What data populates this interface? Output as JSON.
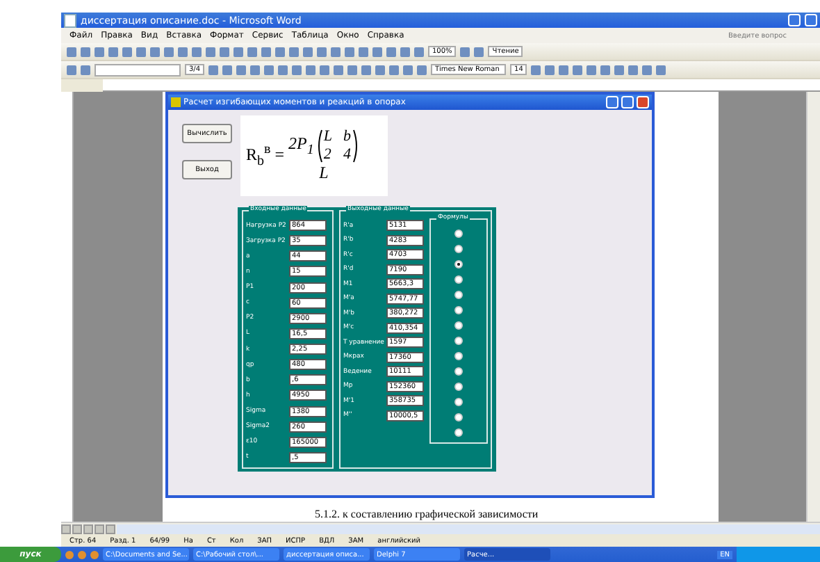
{
  "window": {
    "title": "диссертация описание.doc - Microsoft Word"
  },
  "menu": [
    "Файл",
    "Правка",
    "Вид",
    "Вставка",
    "Формат",
    "Сервис",
    "Таблица",
    "Окно",
    "Справка"
  ],
  "help_search": {
    "placeholder": "Введите вопрос"
  },
  "toolbar": {
    "zoom": "100%",
    "reading": "Чтение",
    "line_width": "3/4",
    "font": "Times New Roman",
    "size": "14"
  },
  "dialog": {
    "title": "Расчет изгибающих моментов и реакций в опорах",
    "buttons": [
      "Вычислить",
      "Выход"
    ],
    "formula": {
      "lhs": "R$_{b}$$^{в}$ =",
      "numerator": "2P$_{1}$",
      "matrix": [
        "L",
        "b",
        "2",
        "4"
      ],
      "denominator": "L"
    },
    "inputs_title": "Входные данные",
    "inputs": [
      {
        "label": "Нагрузка P2",
        "value": "864"
      },
      {
        "label": "Загрузка Р2",
        "value": "35"
      },
      {
        "label": "a",
        "value": "44"
      },
      {
        "label": "n",
        "value": "15"
      },
      {
        "label": "Р1",
        "value": "200"
      },
      {
        "label": "c",
        "value": "60"
      },
      {
        "label": "P2",
        "value": "2900"
      },
      {
        "label": "L",
        "value": "16,5"
      },
      {
        "label": "k",
        "value": "2,25"
      },
      {
        "label": "qp",
        "value": "480"
      },
      {
        "label": "b",
        "value": ",6"
      },
      {
        "label": "h",
        "value": "4950"
      },
      {
        "label": "Sigma",
        "value": "1380"
      },
      {
        "label": "Sigma2",
        "value": "260"
      },
      {
        "label": "ε10",
        "value": "165000"
      },
      {
        "label": "t",
        "value": ",5"
      }
    ],
    "outputs_title": "Выходные данные",
    "outputs": [
      {
        "label": "R'a",
        "value": "5131"
      },
      {
        "label": "R'b",
        "value": "4283"
      },
      {
        "label": "R'c",
        "value": "4703"
      },
      {
        "label": "R'd",
        "value": "7190"
      },
      {
        "label": "M1",
        "value": "5663,3"
      },
      {
        "label": "M'a",
        "value": "5747,77"
      },
      {
        "label": "M'b",
        "value": "380,272"
      },
      {
        "label": "M'c",
        "value": "410,354"
      },
      {
        "label": "T уравнение",
        "value": "1597"
      },
      {
        "label": "Мкрах",
        "value": "17360"
      },
      {
        "label": "Ведение",
        "value": "10111"
      },
      {
        "label": "Мр",
        "value": "152360"
      },
      {
        "label": "M'1",
        "value": "358735"
      },
      {
        "label": "M''",
        "value": "10000,5"
      }
    ],
    "formulas_title": "Формулы",
    "formula_options": [
      {
        "selected": false
      },
      {
        "selected": false
      },
      {
        "selected": true
      },
      {
        "selected": false
      },
      {
        "selected": false
      },
      {
        "selected": false
      },
      {
        "selected": false
      },
      {
        "selected": false
      },
      {
        "selected": false
      },
      {
        "selected": false
      },
      {
        "selected": false
      },
      {
        "selected": false
      },
      {
        "selected": false
      },
      {
        "selected": false
      }
    ]
  },
  "document_text": "5.1.2. к составлению графической зависимости",
  "status_bar": [
    "Стр. 64",
    "Разд. 1",
    "64/99",
    "На",
    "Ст",
    "Кол",
    "ЗАП",
    "ИСПР",
    "ВДЛ",
    "ЗАМ",
    "английский"
  ],
  "taskbar": {
    "start": "пуск",
    "items": [
      {
        "label": "C:\\Documents and Se...",
        "selected": false
      },
      {
        "label": "С:\\Рабочий стол\\...",
        "selected": false
      },
      {
        "label": "диссертация описа...",
        "selected": false
      },
      {
        "label": "Delphi 7",
        "selected": false
      },
      {
        "label": "Расче...",
        "selected": true
      }
    ],
    "language": "EN"
  }
}
